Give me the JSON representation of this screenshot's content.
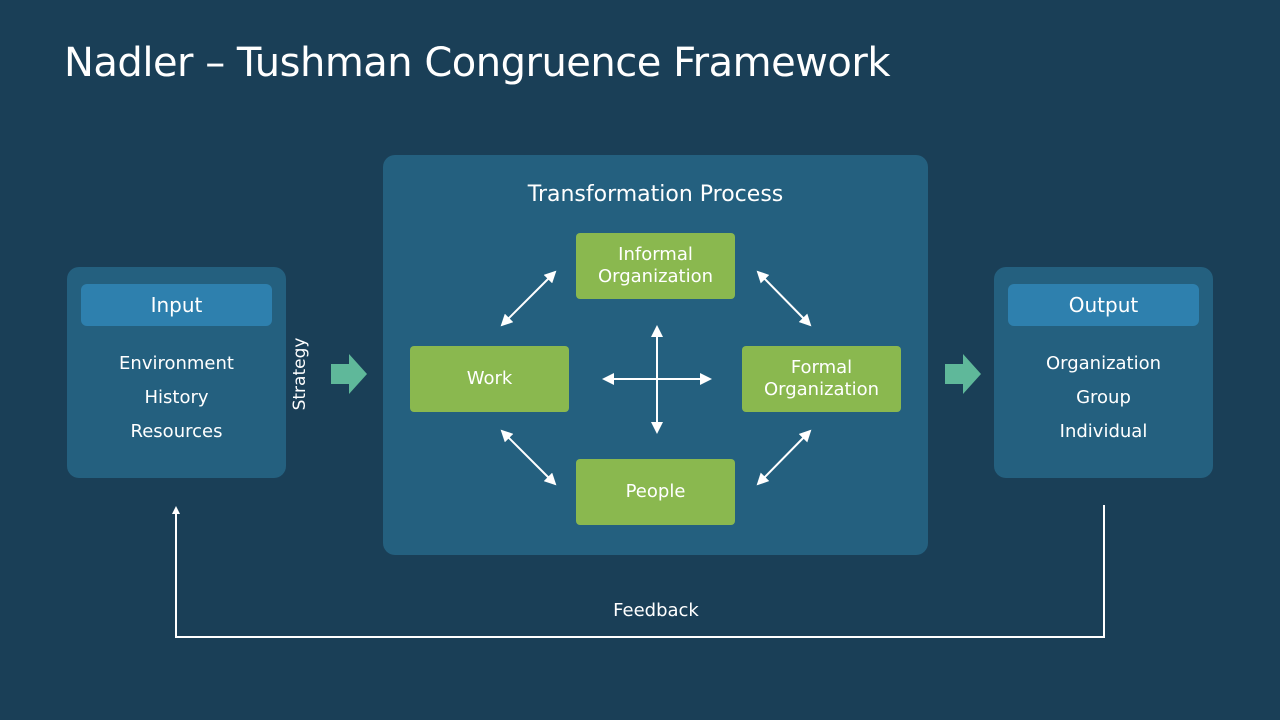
{
  "title": "Nadler – Tushman Congruence Framework",
  "input": {
    "header": "Input",
    "items": [
      "Environment",
      "History",
      "Resources"
    ]
  },
  "strategy_label": "Strategy",
  "transformation": {
    "title": "Transformation Process",
    "components": {
      "informal": "Informal Organization",
      "work": "Work",
      "formal": "Formal Organization",
      "people": "People"
    }
  },
  "output": {
    "header": "Output",
    "items": [
      "Organization",
      "Group",
      "Individual"
    ]
  },
  "feedback_label": "Feedback",
  "colors": {
    "background": "#1a3f57",
    "panel": "#24607f",
    "panel_header": "#2e80ae",
    "component": "#8ab84f",
    "flow_arrow": "#5fb89a"
  }
}
